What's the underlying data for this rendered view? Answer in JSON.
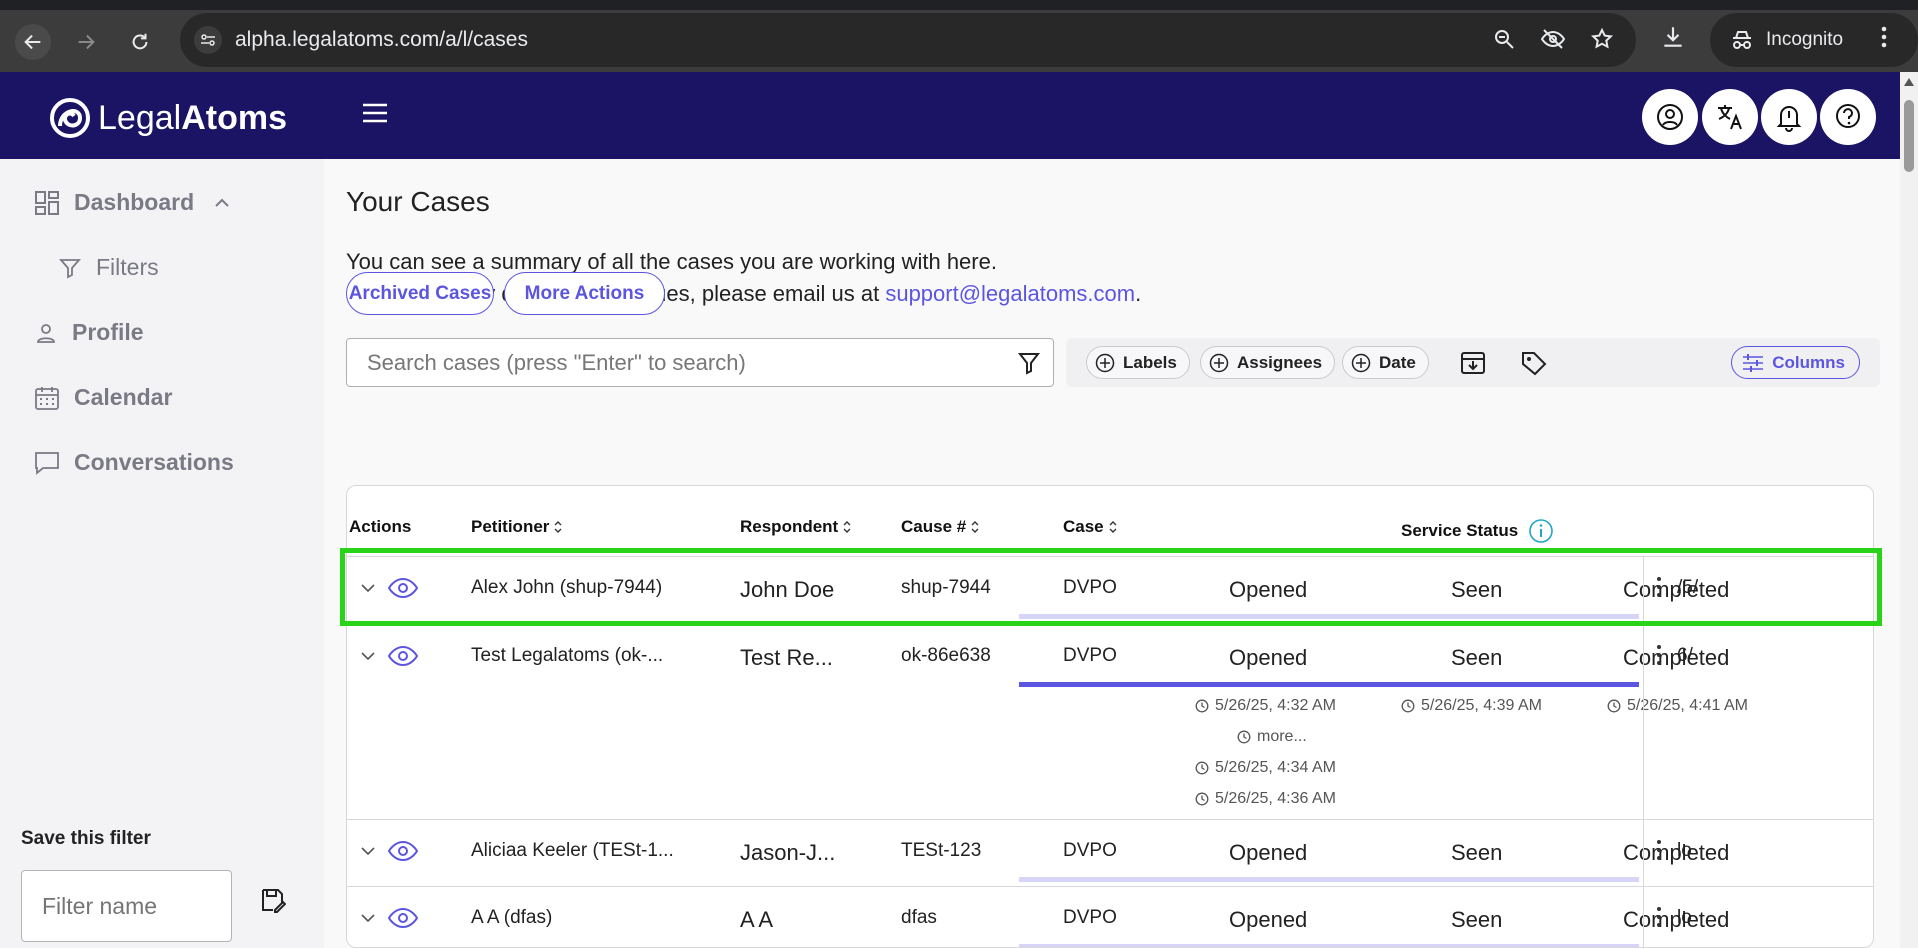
{
  "browser": {
    "url": "alpha.legalatoms.com/a/l/cases",
    "incognito_label": "Incognito"
  },
  "header": {
    "logo_light": "Legal",
    "logo_bold": "Atoms"
  },
  "sidebar": {
    "items": [
      {
        "label": "Dashboard"
      },
      {
        "label": "Filters"
      },
      {
        "label": "Profile"
      },
      {
        "label": "Calendar"
      },
      {
        "label": "Conversations"
      }
    ],
    "save_filter_label": "Save this filter",
    "filter_name_placeholder": "Filter name"
  },
  "main": {
    "title": "Your Cases",
    "desc_line1": "You can see a summary of all the cases you are working with here.",
    "desc_line2": "If you have any questions or issues, please email us at",
    "support_email": "support@legalatoms.com",
    "desc_period": ".",
    "archived_btn": "Archived Cases",
    "more_actions_btn": "More Actions",
    "search_placeholder": "Search cases (press \"Enter\" to search)",
    "chips": {
      "labels": "Labels",
      "assignees": "Assignees",
      "date": "Date"
    },
    "columns_btn": "Columns"
  },
  "table": {
    "headers": {
      "actions": "Actions",
      "petitioner": "Petitioner",
      "respondent": "Respondent",
      "cause": "Cause #",
      "case": "Case",
      "service_status": "Service Status"
    },
    "status_labels": {
      "opened": "Opened",
      "seen": "Seen",
      "completed": "Completed"
    },
    "rows": [
      {
        "petitioner": "Alex John (shup-7944)",
        "respondent": "John Doe",
        "cause": "shup-7944",
        "case": "DVPO",
        "extra": "/5/"
      },
      {
        "petitioner": "Test Legalatoms (ok-...",
        "respondent": "Test Re...",
        "cause": "ok-86e638",
        "case": "DVPO",
        "extra": "6/",
        "opened_ts": "5/26/25, 4:32 AM",
        "more": "more...",
        "opened_ts2": "5/26/25, 4:34 AM",
        "opened_ts3": "5/26/25, 4:36 AM",
        "seen_ts": "5/26/25, 4:39 AM",
        "completed_ts": "5/26/25, 4:41 AM"
      },
      {
        "petitioner": "Aliciaa Keeler (TESt-1...",
        "respondent": "Jason-J...",
        "cause": "TESt-123",
        "case": "DVPO",
        "extra": "lo"
      },
      {
        "petitioner": "A A (dfas)",
        "respondent": "A A",
        "cause": "dfas",
        "case": "DVPO",
        "extra": "lo"
      }
    ]
  }
}
